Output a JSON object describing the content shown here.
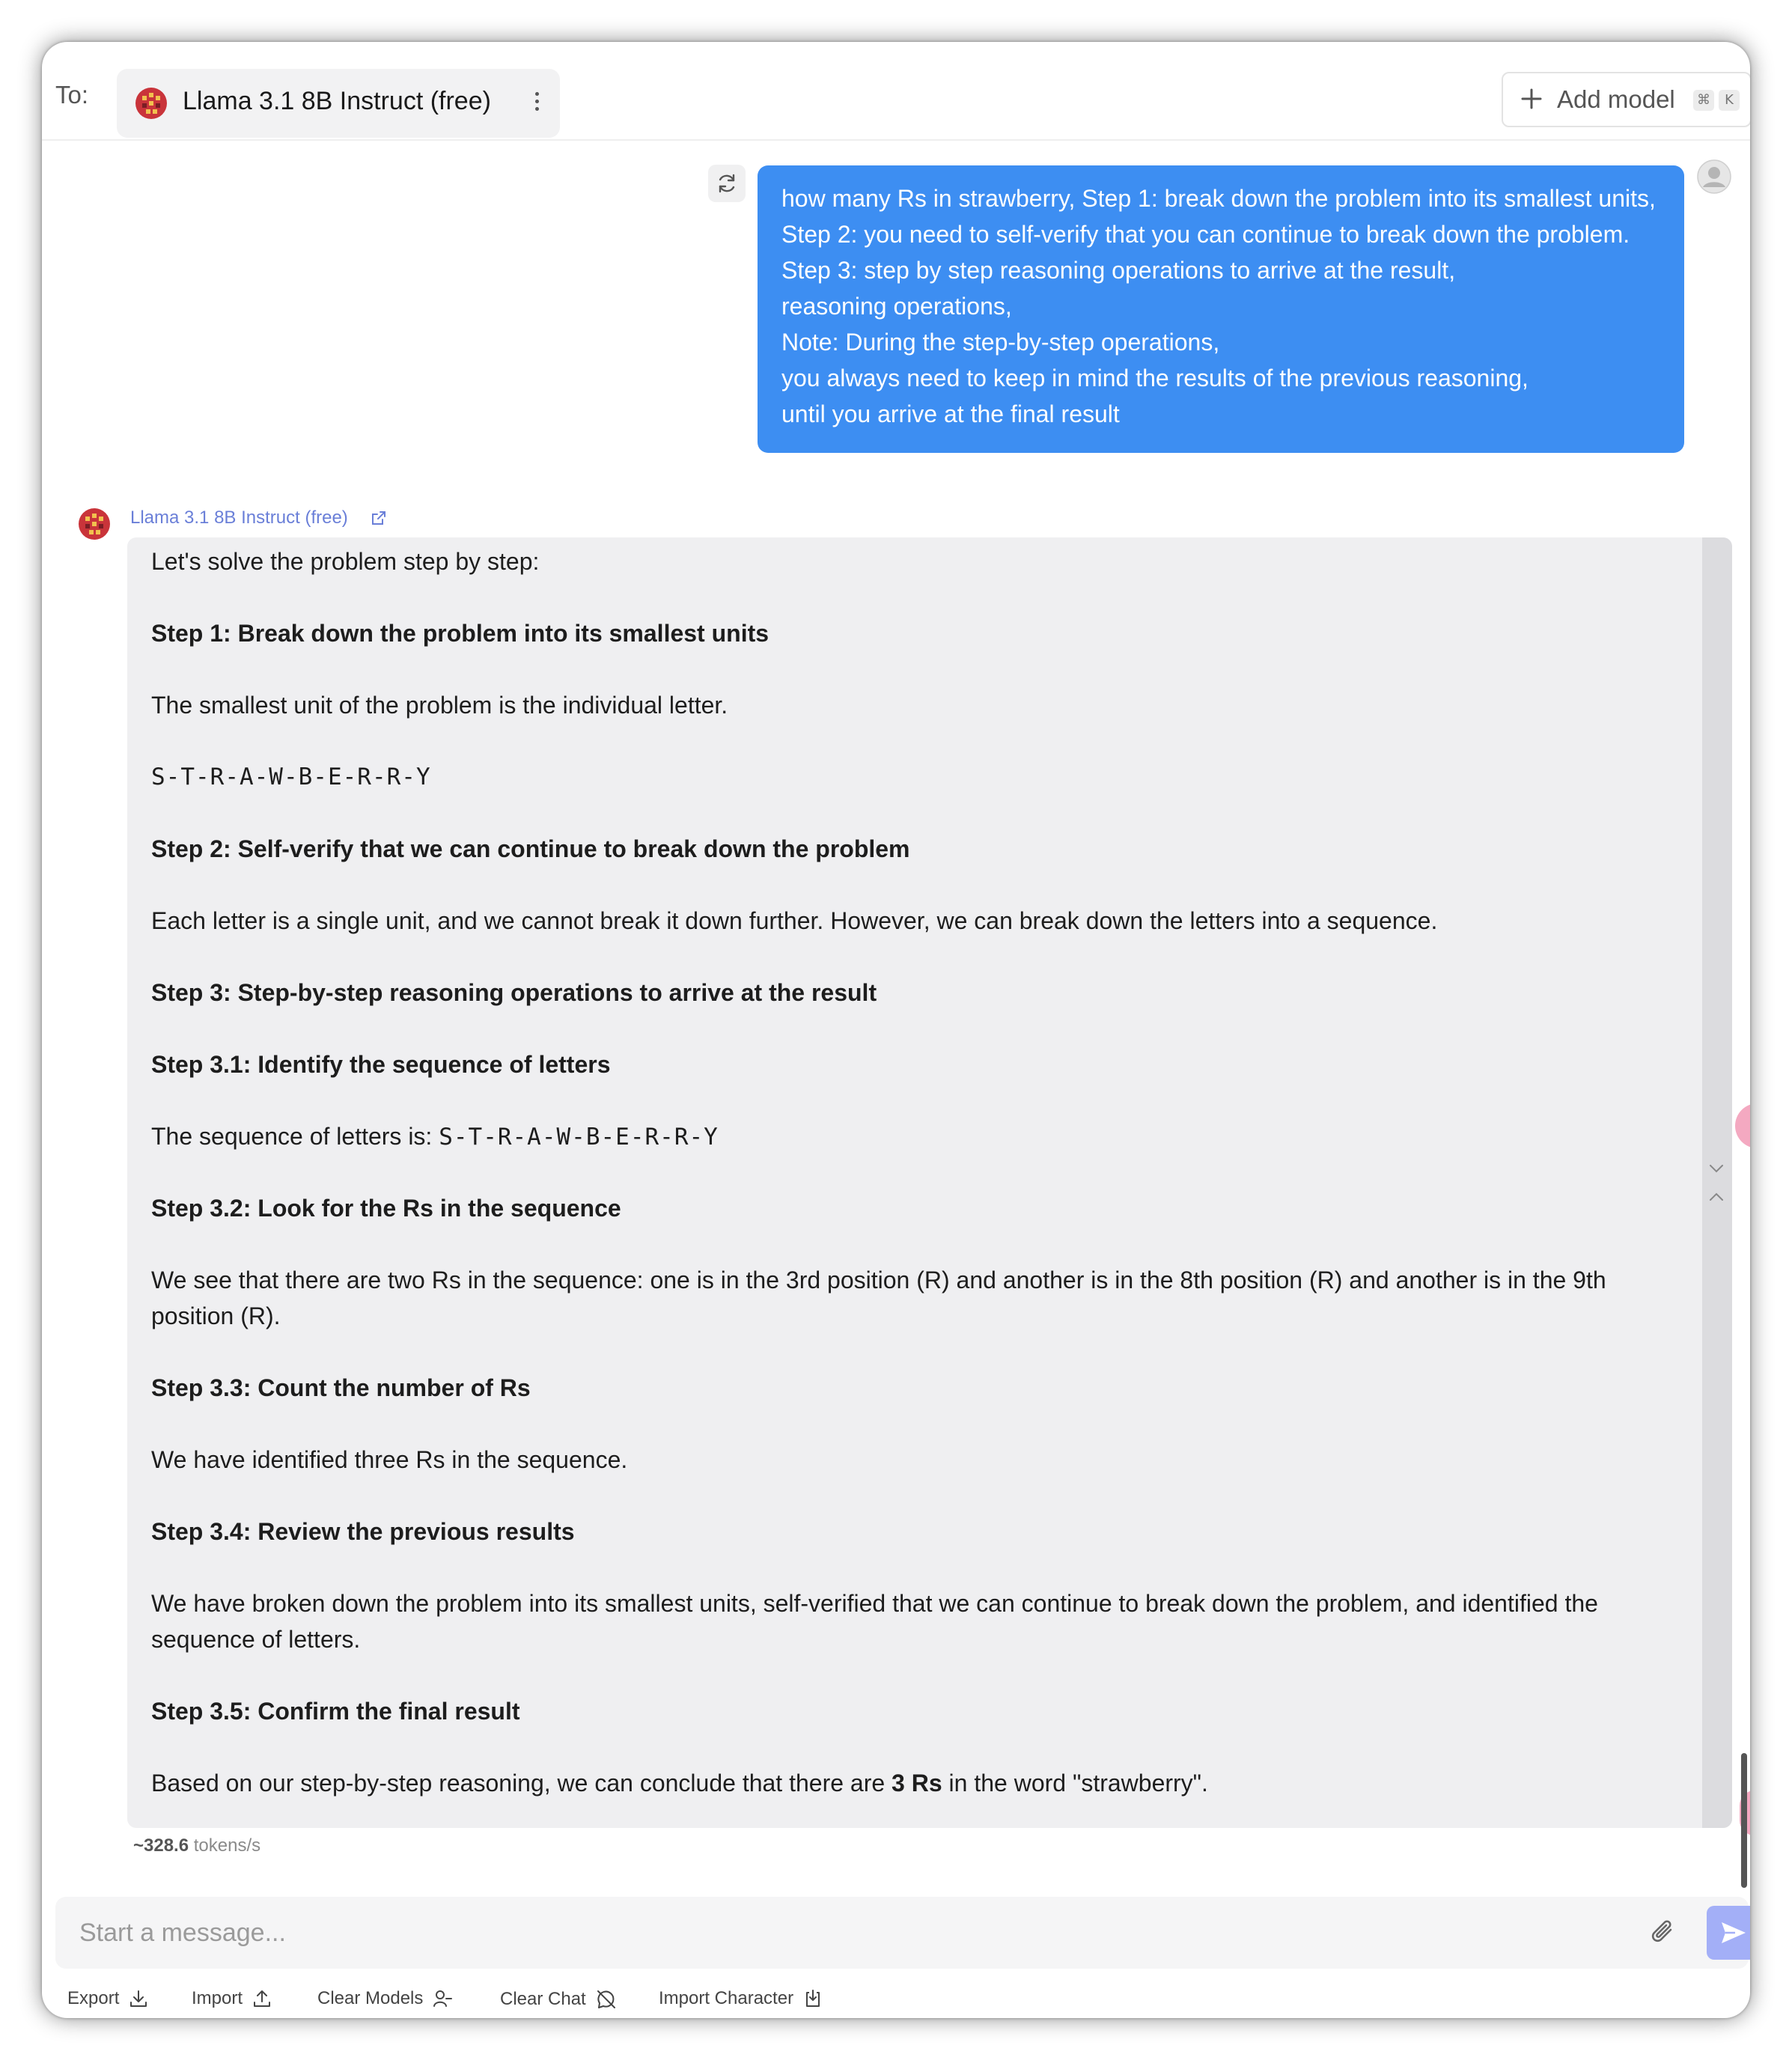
{
  "header": {
    "to_label": "To:",
    "model_name": "Llama 3.1 8B Instruct (free)",
    "add_model_label": "Add model",
    "shortcut_keys": [
      "⌘",
      "K"
    ]
  },
  "user_message": {
    "lines": [
      "how many Rs in strawberry, Step 1: break down the problem into its smallest units,",
      "Step 2: you need to self-verify that you can continue to break down the problem.",
      "Step 3: step by step reasoning operations to arrive at the result,",
      "reasoning operations,",
      "Note: During the step-by-step operations,",
      "you always need to keep in mind the results of the previous reasoning,",
      "until you arrive at the final result"
    ]
  },
  "assistant_message": {
    "model_name": "Llama 3.1 8B Instruct (free)",
    "intro": "Let's solve the problem step by step:",
    "step1_heading": "Step 1: Break down the problem into its smallest units",
    "step1_text": "The smallest unit of the problem is the individual letter.",
    "letters": "S-T-R-A-W-B-E-R-R-Y",
    "step2_heading": "Step 2: Self-verify that we can continue to break down the problem",
    "step2_text": "Each letter is a single unit, and we cannot break it down further. However, we can break down the letters into a sequence.",
    "step3_heading": "Step 3: Step-by-step reasoning operations to arrive at the result",
    "step31_heading": "Step 3.1: Identify the sequence of letters",
    "step31_text_prefix": "The sequence of letters is: ",
    "step31_letters": "S-T-R-A-W-B-E-R-R-Y",
    "step32_heading": "Step 3.2: Look for the Rs in the sequence",
    "step32_text_line1": "We see that there are two Rs in the sequence: one is in the 3rd position (R) and another is in the 8th position (R) and another is in the 9th",
    "step32_text_line2": "position (R).",
    "step33_heading": "Step 3.3: Count the number of Rs",
    "step33_text": "We have identified three Rs in the sequence.",
    "step34_heading": "Step 3.4: Review the previous results",
    "step34_text_line1": "We have broken down the problem into its smallest units, self-verified that we can continue to break down the problem, and identified the",
    "step34_text_line2": "sequence of letters.",
    "step35_heading": "Step 3.5: Confirm the final result",
    "conclusion_prefix": "Based on our step-by-step reasoning, we can conclude that there are ",
    "conclusion_bold": "3 Rs",
    "conclusion_suffix": " in the word \"strawberry\".",
    "speed_value": "~328.6",
    "speed_unit": " tokens/s"
  },
  "composer": {
    "placeholder": "Start a message..."
  },
  "footer": {
    "export_label": "Export",
    "import_label": "Import",
    "clear_models_label": "Clear Models",
    "clear_chat_label": "Clear Chat",
    "import_character_label": "Import Character"
  },
  "colors": {
    "user_bubble": "#3d8ef2",
    "assistant_bubble": "#efeff1",
    "send_button": "#a3aff7",
    "model_link": "#6a7fd8"
  }
}
